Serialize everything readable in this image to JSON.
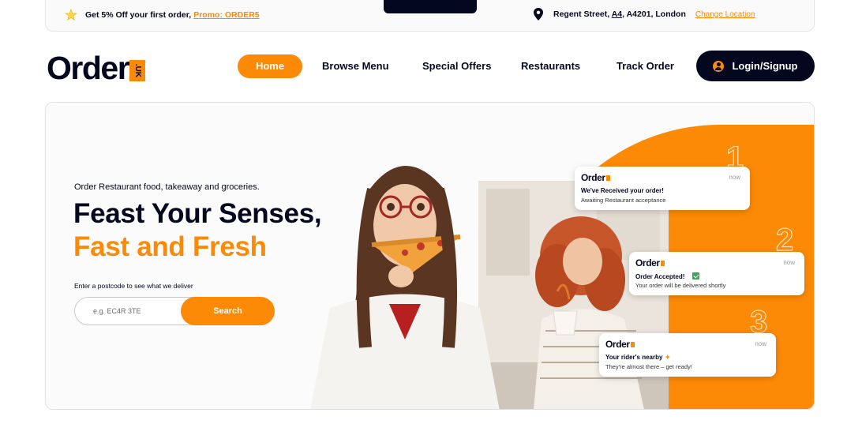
{
  "promo": {
    "text": "Get 5% Off your first order,",
    "code": "Promo: ORDER5"
  },
  "location": {
    "prefix": "Regent Street,",
    "underlined": "A4",
    "suffix": ", A4201, London",
    "change_label": "Change Location"
  },
  "brand": {
    "name": "Order",
    "badge": ".UK",
    "accent": "#fc8a06",
    "dark": "#03081f"
  },
  "nav": {
    "items": [
      {
        "label": "Home",
        "active": true
      },
      {
        "label": "Browse Menu",
        "active": false
      },
      {
        "label": "Special Offers",
        "active": false
      },
      {
        "label": "Restaurants",
        "active": false
      },
      {
        "label": "Track Order",
        "active": false
      }
    ],
    "login_label": "Login/Signup"
  },
  "hero": {
    "tagline": "Order Restaurant food, takeaway and groceries.",
    "headline_1": "Feast Your Senses,",
    "headline_2": "Fast and Fresh",
    "postcode_label": "Enter a postcode to see what we deliver",
    "search_placeholder": "e.g. EC4R 3TE",
    "search_button": "Search"
  },
  "notifications": [
    {
      "step": "1",
      "brand": "Order",
      "time": "now",
      "title": "We've Received your order!",
      "subtitle": "Awaiting Restaurant acceptance"
    },
    {
      "step": "2",
      "brand": "Order",
      "time": "now",
      "title": "Order Accepted!",
      "subtitle": "Your order will be delivered shortly"
    },
    {
      "step": "3",
      "brand": "Order",
      "time": "now",
      "title": "Your rider's nearby",
      "subtitle": "They're almost there – get ready!"
    }
  ]
}
